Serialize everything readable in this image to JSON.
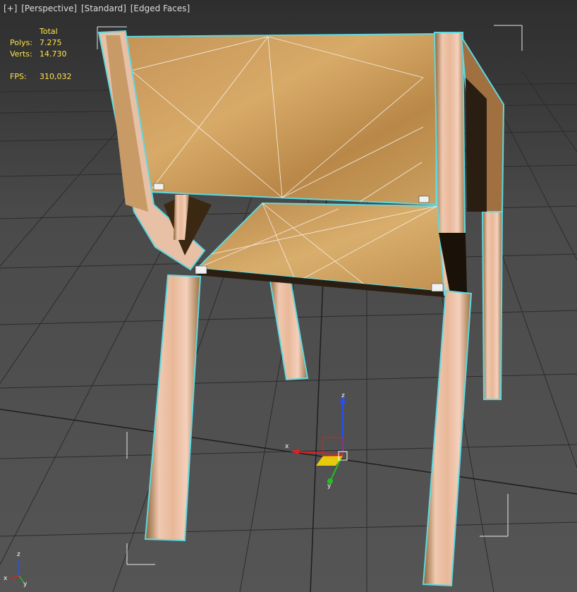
{
  "viewport": {
    "labels": {
      "plus": "[+]",
      "view": "[Perspective]",
      "shading": "[Standard]",
      "edges": "[Edged Faces]"
    },
    "stats": {
      "header": "Total",
      "polys_label": "Polys:",
      "polys_value": "7.275",
      "verts_label": "Verts:",
      "verts_value": "14.730",
      "fps_label": "FPS:",
      "fps_value": "310,032"
    },
    "gizmo_axes": {
      "x": "x",
      "y": "y",
      "z": "z"
    },
    "axis_tripod": {
      "x": "x",
      "y": "y",
      "z": "z"
    },
    "colors": {
      "stats_text": "#ffe34d",
      "selection_outline": "#5fd8e0",
      "axis_x": "#e02020",
      "axis_y": "#20c020",
      "axis_z": "#2050ff",
      "wood": "#c9995a"
    },
    "scene_object": "wooden chair (OSB plywood)"
  }
}
